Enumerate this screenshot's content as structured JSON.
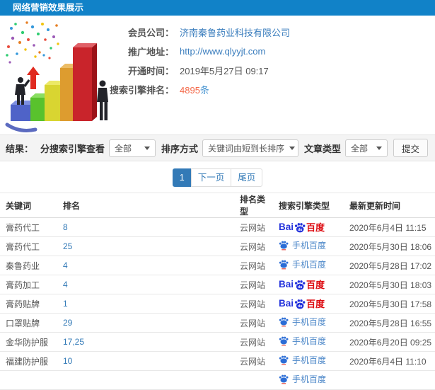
{
  "header": {
    "title": "网络营销效果展示"
  },
  "info": {
    "company_label": "会员公司：",
    "company_value": "济南秦鲁药业科技有限公司",
    "url_label": "推广地址：",
    "url_value": "http://www.qlyyjt.com",
    "open_time_label": "开通时间：",
    "open_time_value": "2019年5月27日 09:17",
    "rank_count_label": "搜索引擎排名：",
    "rank_count_value": "4895",
    "rank_count_unit": "条"
  },
  "filters": {
    "result_label": "结果：",
    "engine_view_label": "分搜索引擎查看",
    "engine_view_value": "全部",
    "sort_label": "排序方式",
    "sort_value": "关键词由短到长排序",
    "article_type_label": "文章类型",
    "article_type_value": "全部",
    "submit_label": "提交"
  },
  "pagination": {
    "current": "1",
    "next_label": "下一页",
    "last_label": "尾页"
  },
  "engines": {
    "baidu": {
      "latin": "Bai",
      "du": "du",
      "chinese": "百度"
    },
    "mobile_baidu": {
      "label": "手机百度"
    }
  },
  "table": {
    "columns": [
      "关键词",
      "排名",
      "排名类型",
      "搜索引擎类型",
      "最新更新时间"
    ],
    "rows": [
      {
        "keyword": "膏药代工",
        "rank": "8",
        "rank_type": "云网站",
        "engine": "baidu",
        "updated": "2020年6月4日 11:15"
      },
      {
        "keyword": "膏药代工",
        "rank": "25",
        "rank_type": "云网站",
        "engine": "mobile_baidu",
        "updated": "2020年5月30日 18:06"
      },
      {
        "keyword": "秦鲁药业",
        "rank": "4",
        "rank_type": "云网站",
        "engine": "mobile_baidu",
        "updated": "2020年5月28日 17:02"
      },
      {
        "keyword": "膏药加工",
        "rank": "4",
        "rank_type": "云网站",
        "engine": "baidu",
        "updated": "2020年5月30日 18:03"
      },
      {
        "keyword": "膏药贴牌",
        "rank": "1",
        "rank_type": "云网站",
        "engine": "baidu",
        "updated": "2020年5月30日 17:58"
      },
      {
        "keyword": "口罩贴牌",
        "rank": "29",
        "rank_type": "云网站",
        "engine": "mobile_baidu",
        "updated": "2020年5月28日 16:55"
      },
      {
        "keyword": "金华防护服",
        "rank": "17,25",
        "rank_type": "云网站",
        "engine": "mobile_baidu",
        "updated": "2020年6月20日 09:25"
      },
      {
        "keyword": "福建防护服",
        "rank": "10",
        "rank_type": "云网站",
        "engine": "mobile_baidu",
        "updated": "2020年6月4日 11:10"
      },
      {
        "keyword": "",
        "rank": "",
        "rank_type": "",
        "engine": "mobile_baidu",
        "updated": ""
      }
    ]
  },
  "colors": {
    "header_bg": "#1182c8",
    "link": "#3a7dbd",
    "count_red": "#f4694a",
    "pagination_active": "#337ab7",
    "baidu_blue": "#2433dc",
    "baidu_red": "#dd0a10"
  }
}
